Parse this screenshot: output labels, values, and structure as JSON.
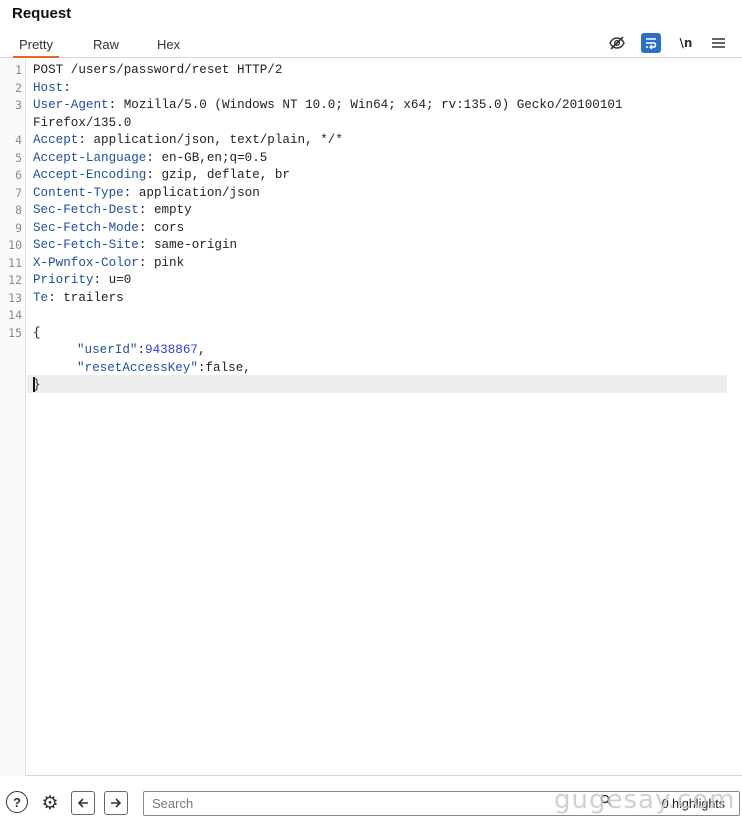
{
  "panel": {
    "title": "Request"
  },
  "tabs": [
    {
      "label": "Pretty",
      "active": true
    },
    {
      "label": "Raw",
      "active": false
    },
    {
      "label": "Hex",
      "active": false
    }
  ],
  "toolbar": {
    "hide_icon": "eye-slash-icon",
    "wrap_icon": "word-wrap-icon",
    "newline_label": "\\n",
    "menu_icon": "hamburger-menu-icon",
    "accent": "#2b6fc7"
  },
  "editor": {
    "line_numbers": [
      "1",
      "2",
      "3",
      "",
      "4",
      "5",
      "6",
      "7",
      "8",
      "9",
      "10",
      "11",
      "12",
      "13",
      "14",
      "15"
    ],
    "request_line": "POST /users/password/reset HTTP/2",
    "headers": [
      {
        "name": "Host",
        "value": ""
      },
      {
        "name": "User-Agent",
        "value": "Mozilla/5.0 (Windows NT 10.0; Win64; x64; rv:135.0) Gecko/20100101"
      },
      {
        "name": "",
        "value": "Firefox/135.0"
      },
      {
        "name": "Accept",
        "value": "application/json, text/plain, */*"
      },
      {
        "name": "Accept-Language",
        "value": "en-GB,en;q=0.5"
      },
      {
        "name": "Accept-Encoding",
        "value": "gzip, deflate, br"
      },
      {
        "name": "Content-Type",
        "value": "application/json"
      },
      {
        "name": "Sec-Fetch-Dest",
        "value": "empty"
      },
      {
        "name": "Sec-Fetch-Mode",
        "value": "cors"
      },
      {
        "name": "Sec-Fetch-Site",
        "value": "same-origin"
      },
      {
        "name": "X-Pwnfox-Color",
        "value": "pink"
      },
      {
        "name": "Priority",
        "value": "u=0"
      },
      {
        "name": "Te",
        "value": "trailers"
      }
    ],
    "body": {
      "open": "{",
      "fields": [
        {
          "key": "\"userId\"",
          "value": "9438867",
          "type": "number"
        },
        {
          "key": "\"resetAccessKey\"",
          "value": "false",
          "type": "bool"
        }
      ],
      "close": "}"
    }
  },
  "bottombar": {
    "search_placeholder": "Search",
    "highlights": "0 highlights",
    "watermark": "gugesay.com"
  }
}
